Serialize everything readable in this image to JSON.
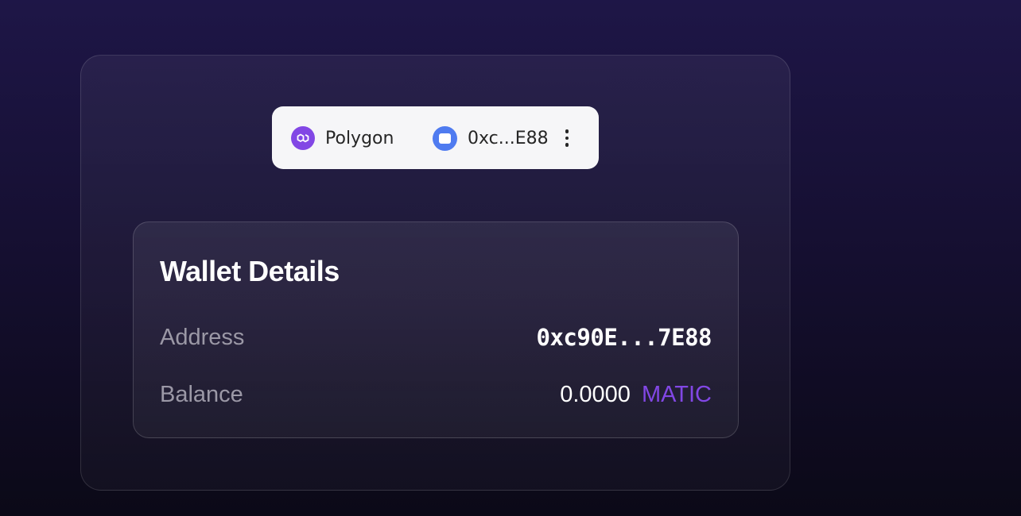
{
  "connect_bar": {
    "network": {
      "name": "Polygon",
      "icon": "polygon-icon",
      "color": "#8247e5"
    },
    "account": {
      "label": "0xc...E88",
      "icon": "wallet-icon",
      "color": "#4f7bf0"
    },
    "menu_icon": "more-vertical-icon"
  },
  "wallet_details": {
    "title": "Wallet Details",
    "address_label": "Address",
    "address_value": "0xc90E...7E88",
    "balance_label": "Balance",
    "balance_amount": "0.0000",
    "balance_symbol": "MATIC",
    "symbol_color": "#8247e5"
  }
}
